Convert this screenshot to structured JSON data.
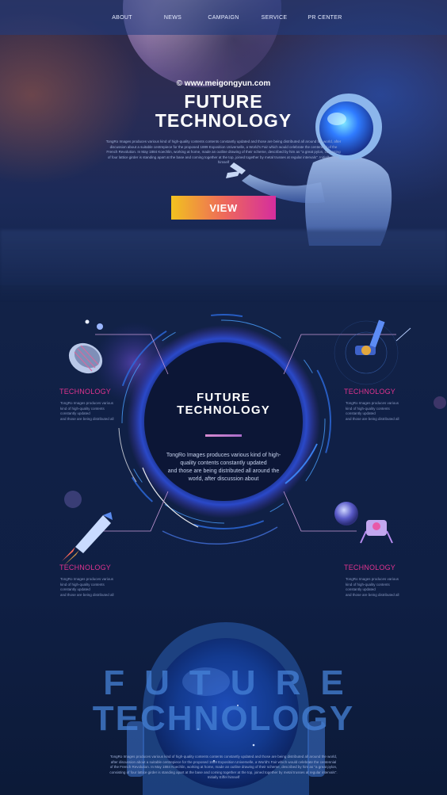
{
  "nav": {
    "items": [
      {
        "label": "ABOUT"
      },
      {
        "label": "NEWS"
      },
      {
        "label": "CAMPAIGN"
      },
      {
        "label": "SERVICE"
      },
      {
        "label": "PR CENTER"
      }
    ]
  },
  "hero": {
    "watermark": "© www.meigongyun.com",
    "title_line1": "FUTURE",
    "title_line2": "TECHNOLOGY",
    "description": "TongRo Images produces various kind of high-quality contents contents constantly updated and those are being distributed all around the world, after discussion about a suitable centrepiece for the proposed 1889 Exposition Universelle, a World's Fair which would celebrate the centennial of the French Revolution. In May 1884 Koechlin, working at home, made an outline drawing of their scheme, described by him as \"a great pylon, consisting of four lattice girder is standing apart at the base and coming together at the top, joined together by metal trusses at regular intervals\". Initially Eiffel himself",
    "view_button": "VIEW"
  },
  "center": {
    "title_line1": "FUTURE",
    "title_line2": "TECHNOLOGY",
    "description_line1": "TongRo Images produces various kind of high-",
    "description_line2": "quality contents constantly updated",
    "description_line3": "and those are being distributed all around the",
    "description_line4": "world, after discussion about"
  },
  "features": [
    {
      "label": "TECHNOLOGY",
      "line1": "TongRo Images produces various",
      "line2": "kind of high-quality contents",
      "line3": "constantly updated",
      "line4": "and those are being distributed all"
    },
    {
      "label": "TECHNOLOGY",
      "line1": "TongRo Images produces various",
      "line2": "kind of high-quality contents",
      "line3": "constantly updated",
      "line4": "and those are being distributed all"
    },
    {
      "label": "TECHNOLOGY",
      "line1": "TongRo Images produces various",
      "line2": "kind of high-quality contents",
      "line3": "constantly updated",
      "line4": "and those are being distributed all"
    },
    {
      "label": "TECHNOLOGY",
      "line1": "TongRo Images produces various",
      "line2": "kind of high-quality contents",
      "line3": "constantly updated",
      "line4": "and those are being distributed all"
    }
  ],
  "bottom": {
    "big_line1": "FUTURE",
    "big_line2": "TECHNOLOGY",
    "description": "TongRo Images produces various kind of high-quality contents contents constantly updated and those are being distributed all around the world, after discussion about a suitable centrepiece for the proposed 1889 Exposition Universelle, a World's Fair which would celebrate the centennial of the French Revolution. In May 1884 Koechlin, working at home, made an outline drawing of their scheme, described by him as \"a great pylon, consisting of four lattice girder is standing apart at the base and coming together at the top, joined together by metal trusses at regular intervals\". Initially Eiffel himself"
  },
  "colors": {
    "accent_pink": "#e0338e",
    "button_gradient_start": "#f2c21f",
    "button_gradient_end": "#d52d9e",
    "background": "#0f1e3c"
  }
}
